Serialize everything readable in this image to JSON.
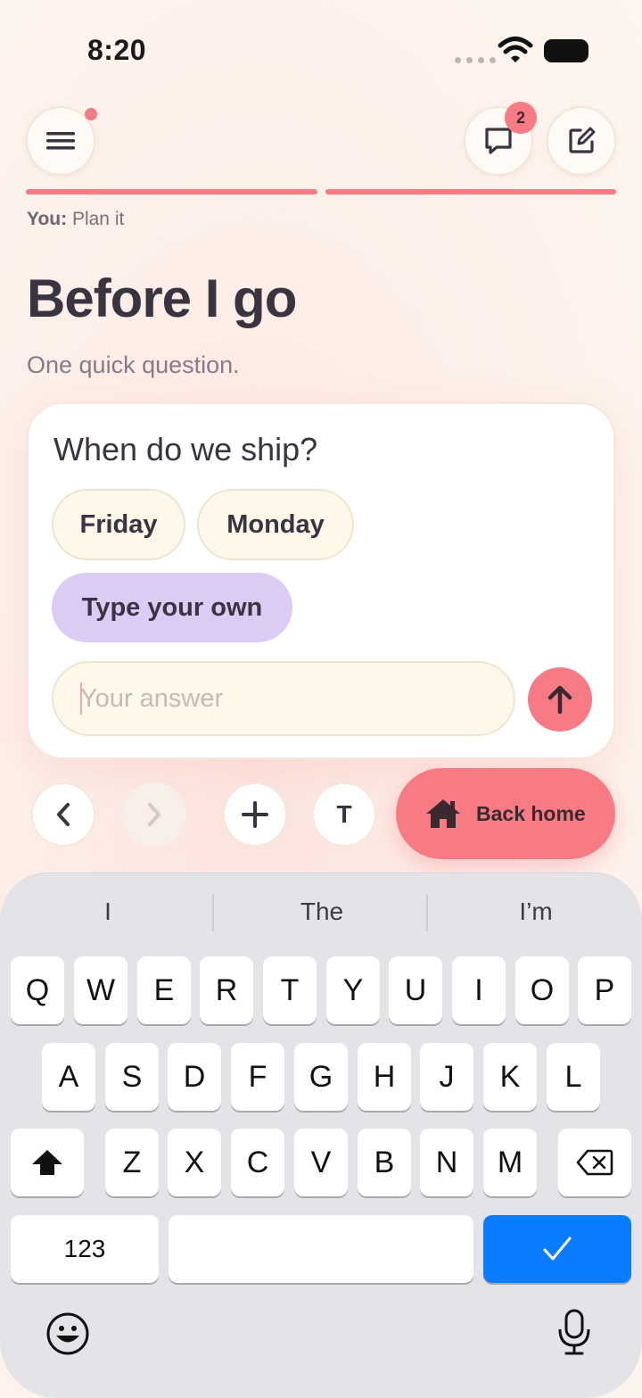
{
  "status_bar": {
    "time": "8:20"
  },
  "header": {
    "notification_count": "2"
  },
  "progress": {
    "segments_filled": 2,
    "segments_total": 2
  },
  "breadcrumb": {
    "prefix": "You:",
    "text": "Plan it"
  },
  "page": {
    "title": "Before I go",
    "subtitle": "One quick question."
  },
  "question_card": {
    "question": "When do we ship?",
    "options": [
      "Friday",
      "Monday"
    ],
    "custom_option": "Type your own",
    "answer_placeholder": "Your answer",
    "answer_value": ""
  },
  "toolbar": {
    "text_label": "T",
    "home_label": "Back home"
  },
  "keyboard": {
    "suggestions": [
      "I",
      "The",
      "I’m"
    ],
    "rows": [
      [
        "Q",
        "W",
        "E",
        "R",
        "T",
        "Y",
        "U",
        "I",
        "O",
        "P"
      ],
      [
        "A",
        "S",
        "D",
        "F",
        "G",
        "H",
        "J",
        "K",
        "L"
      ],
      [
        "Z",
        "X",
        "C",
        "V",
        "B",
        "N",
        "M"
      ]
    ],
    "numbers_label": "123"
  },
  "colors": {
    "accent": "#f77b84",
    "custom_chip": "#dcccf5",
    "option_chip": "#fdf8ea",
    "return_key": "#0a7cff",
    "keyboard_bg": "#e4e3e8"
  },
  "icons": [
    "menu-icon",
    "chat-icon",
    "edit-icon",
    "arrow-up-icon",
    "chevron-left-icon",
    "chevron-right-icon",
    "plus-icon",
    "home-icon",
    "shift-icon",
    "backspace-icon",
    "checkmark-icon",
    "emoji-icon",
    "microphone-icon"
  ]
}
